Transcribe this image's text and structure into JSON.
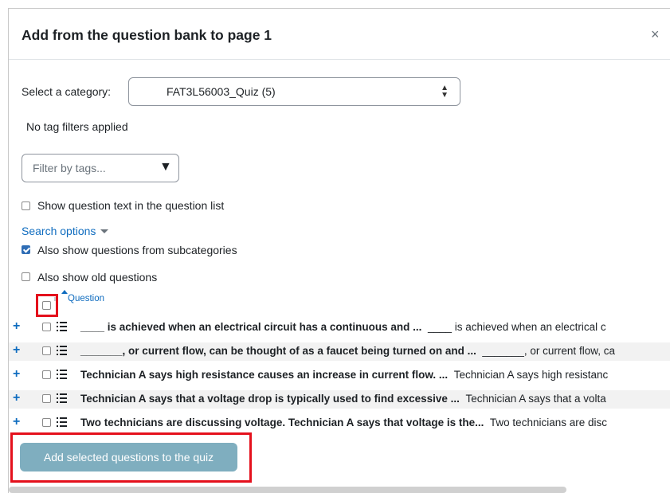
{
  "modal": {
    "title": "Add from the question bank to page 1",
    "close_glyph": "×"
  },
  "category": {
    "label": "Select a category:",
    "selected": "FAT3L56003_Quiz (5)"
  },
  "tags": {
    "status": "No tag filters applied",
    "placeholder": "Filter by tags...",
    "dropdown_glyph": "▼"
  },
  "options": {
    "show_text_label": "Show question text in the question list",
    "show_text_checked": false,
    "search_options_label": "Search options",
    "subcategories_label": "Also show questions from subcategories",
    "subcategories_checked": true,
    "old_questions_label": "Also show old questions",
    "old_questions_checked": false
  },
  "table": {
    "header_label": "Question",
    "sort_indicator": "I",
    "rows": [
      {
        "name": "____ is achieved when an electrical circuit has a continuous and ...",
        "text": "____ is achieved when an electrical c"
      },
      {
        "name": "_______, or current flow, can be thought of as a faucet being turned on and ...",
        "text": "_______, or current flow, ca"
      },
      {
        "name": "Technician A says high resistance causes an increase in current flow. ...",
        "text": "Technician A says high resistanc"
      },
      {
        "name": "Technician A says that a voltage drop is typically used to find excessive ...",
        "text": "Technician A says that a volta"
      },
      {
        "name": "Two technicians are discussing voltage. Technician A says that voltage is the...",
        "text": "Two technicians are disc"
      }
    ]
  },
  "actions": {
    "add_selected_label": "Add selected questions to the quiz"
  },
  "colors": {
    "accent": "#0f6cbf",
    "button_disabled": "#7faebf",
    "highlight": "#e4101c",
    "checkbox_checked": "#2f6db5"
  },
  "icons": {
    "add": "plus-icon",
    "type": "list-icon",
    "close": "close-icon",
    "select": "updown-arrows-icon",
    "dropdown": "triangle-down-icon"
  }
}
